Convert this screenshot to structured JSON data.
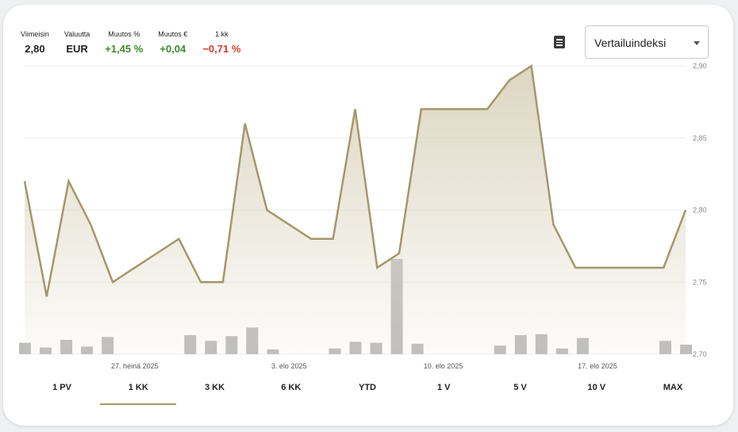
{
  "stats": [
    {
      "label": "Viimeisin",
      "value": "2,80",
      "tone": "neutral"
    },
    {
      "label": "Valuutta",
      "value": "EUR",
      "tone": "neutral"
    },
    {
      "label": "Muutos %",
      "value": "+1,45 %",
      "tone": "pos"
    },
    {
      "label": "Muutos €",
      "value": "+0,04",
      "tone": "pos"
    },
    {
      "label": "1 kk",
      "value": "−0,71 %",
      "tone": "neg"
    }
  ],
  "compare_select": {
    "value": "Vertailuindeksi"
  },
  "tabs": [
    "1 PV",
    "1 KK",
    "3 KK",
    "6 KK",
    "YTD",
    "1 V",
    "5 V",
    "10 V",
    "MAX"
  ],
  "active_tab": 1,
  "colors": {
    "line": "#a39869",
    "area_top": "#ddd6c2",
    "volume": "#bdbdbd",
    "positive": "#3d8b2a",
    "negative": "#d63b2f"
  },
  "chart_data": {
    "type": "area",
    "y_axis": {
      "ticks": [
        "2,90",
        "2,85",
        "2,80",
        "2,75",
        "2,70"
      ],
      "ylim": [
        2.7,
        2.9
      ]
    },
    "x_axis": {
      "ticks": [
        {
          "label": "27. heinä 2025",
          "index": 5
        },
        {
          "label": "3. elo 2025",
          "index": 12
        },
        {
          "label": "10. elo 2025",
          "index": 19
        },
        {
          "label": "17. elo 2025",
          "index": 26
        }
      ]
    },
    "grid": true,
    "series": [
      {
        "values": [
          2.82,
          2.74,
          2.82,
          2.79,
          2.75,
          2.76,
          2.77,
          2.78,
          2.75,
          2.75,
          2.86,
          2.8,
          2.79,
          2.78,
          2.78,
          2.87,
          2.76,
          2.77,
          2.87,
          2.87,
          2.87,
          2.87,
          2.89,
          2.9,
          2.79,
          2.76,
          2.76,
          2.76,
          2.76,
          2.76,
          2.8
        ]
      }
    ],
    "volume": [
      0.12,
      0.07,
      0.15,
      0.08,
      0.18,
      0,
      0,
      0,
      0.2,
      0.14,
      0.19,
      0.28,
      0.05,
      0,
      0,
      0.06,
      0.13,
      0.12,
      1.0,
      0.11,
      0,
      0,
      0,
      0.09,
      0.2,
      0.21,
      0.06,
      0.17,
      0,
      0,
      0,
      0.14,
      0.1
    ]
  }
}
